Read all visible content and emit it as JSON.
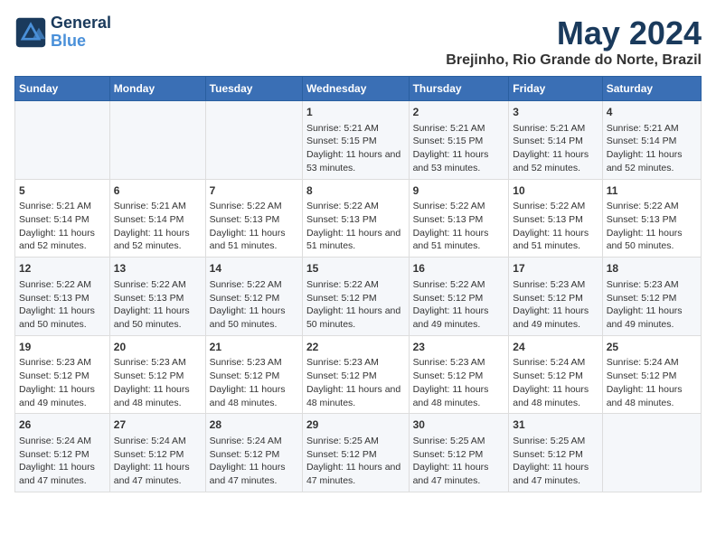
{
  "header": {
    "logo_line1": "General",
    "logo_line2": "Blue",
    "month_title": "May 2024",
    "subtitle": "Brejinho, Rio Grande do Norte, Brazil"
  },
  "weekdays": [
    "Sunday",
    "Monday",
    "Tuesday",
    "Wednesday",
    "Thursday",
    "Friday",
    "Saturday"
  ],
  "weeks": [
    [
      {
        "day": "",
        "content": ""
      },
      {
        "day": "",
        "content": ""
      },
      {
        "day": "",
        "content": ""
      },
      {
        "day": "1",
        "content": "Sunrise: 5:21 AM\nSunset: 5:15 PM\nDaylight: 11 hours and 53 minutes."
      },
      {
        "day": "2",
        "content": "Sunrise: 5:21 AM\nSunset: 5:15 PM\nDaylight: 11 hours and 53 minutes."
      },
      {
        "day": "3",
        "content": "Sunrise: 5:21 AM\nSunset: 5:14 PM\nDaylight: 11 hours and 52 minutes."
      },
      {
        "day": "4",
        "content": "Sunrise: 5:21 AM\nSunset: 5:14 PM\nDaylight: 11 hours and 52 minutes."
      }
    ],
    [
      {
        "day": "5",
        "content": "Sunrise: 5:21 AM\nSunset: 5:14 PM\nDaylight: 11 hours and 52 minutes."
      },
      {
        "day": "6",
        "content": "Sunrise: 5:21 AM\nSunset: 5:14 PM\nDaylight: 11 hours and 52 minutes."
      },
      {
        "day": "7",
        "content": "Sunrise: 5:22 AM\nSunset: 5:13 PM\nDaylight: 11 hours and 51 minutes."
      },
      {
        "day": "8",
        "content": "Sunrise: 5:22 AM\nSunset: 5:13 PM\nDaylight: 11 hours and 51 minutes."
      },
      {
        "day": "9",
        "content": "Sunrise: 5:22 AM\nSunset: 5:13 PM\nDaylight: 11 hours and 51 minutes."
      },
      {
        "day": "10",
        "content": "Sunrise: 5:22 AM\nSunset: 5:13 PM\nDaylight: 11 hours and 51 minutes."
      },
      {
        "day": "11",
        "content": "Sunrise: 5:22 AM\nSunset: 5:13 PM\nDaylight: 11 hours and 50 minutes."
      }
    ],
    [
      {
        "day": "12",
        "content": "Sunrise: 5:22 AM\nSunset: 5:13 PM\nDaylight: 11 hours and 50 minutes."
      },
      {
        "day": "13",
        "content": "Sunrise: 5:22 AM\nSunset: 5:13 PM\nDaylight: 11 hours and 50 minutes."
      },
      {
        "day": "14",
        "content": "Sunrise: 5:22 AM\nSunset: 5:12 PM\nDaylight: 11 hours and 50 minutes."
      },
      {
        "day": "15",
        "content": "Sunrise: 5:22 AM\nSunset: 5:12 PM\nDaylight: 11 hours and 50 minutes."
      },
      {
        "day": "16",
        "content": "Sunrise: 5:22 AM\nSunset: 5:12 PM\nDaylight: 11 hours and 49 minutes."
      },
      {
        "day": "17",
        "content": "Sunrise: 5:23 AM\nSunset: 5:12 PM\nDaylight: 11 hours and 49 minutes."
      },
      {
        "day": "18",
        "content": "Sunrise: 5:23 AM\nSunset: 5:12 PM\nDaylight: 11 hours and 49 minutes."
      }
    ],
    [
      {
        "day": "19",
        "content": "Sunrise: 5:23 AM\nSunset: 5:12 PM\nDaylight: 11 hours and 49 minutes."
      },
      {
        "day": "20",
        "content": "Sunrise: 5:23 AM\nSunset: 5:12 PM\nDaylight: 11 hours and 48 minutes."
      },
      {
        "day": "21",
        "content": "Sunrise: 5:23 AM\nSunset: 5:12 PM\nDaylight: 11 hours and 48 minutes."
      },
      {
        "day": "22",
        "content": "Sunrise: 5:23 AM\nSunset: 5:12 PM\nDaylight: 11 hours and 48 minutes."
      },
      {
        "day": "23",
        "content": "Sunrise: 5:23 AM\nSunset: 5:12 PM\nDaylight: 11 hours and 48 minutes."
      },
      {
        "day": "24",
        "content": "Sunrise: 5:24 AM\nSunset: 5:12 PM\nDaylight: 11 hours and 48 minutes."
      },
      {
        "day": "25",
        "content": "Sunrise: 5:24 AM\nSunset: 5:12 PM\nDaylight: 11 hours and 48 minutes."
      }
    ],
    [
      {
        "day": "26",
        "content": "Sunrise: 5:24 AM\nSunset: 5:12 PM\nDaylight: 11 hours and 47 minutes."
      },
      {
        "day": "27",
        "content": "Sunrise: 5:24 AM\nSunset: 5:12 PM\nDaylight: 11 hours and 47 minutes."
      },
      {
        "day": "28",
        "content": "Sunrise: 5:24 AM\nSunset: 5:12 PM\nDaylight: 11 hours and 47 minutes."
      },
      {
        "day": "29",
        "content": "Sunrise: 5:25 AM\nSunset: 5:12 PM\nDaylight: 11 hours and 47 minutes."
      },
      {
        "day": "30",
        "content": "Sunrise: 5:25 AM\nSunset: 5:12 PM\nDaylight: 11 hours and 47 minutes."
      },
      {
        "day": "31",
        "content": "Sunrise: 5:25 AM\nSunset: 5:12 PM\nDaylight: 11 hours and 47 minutes."
      },
      {
        "day": "",
        "content": ""
      }
    ]
  ]
}
